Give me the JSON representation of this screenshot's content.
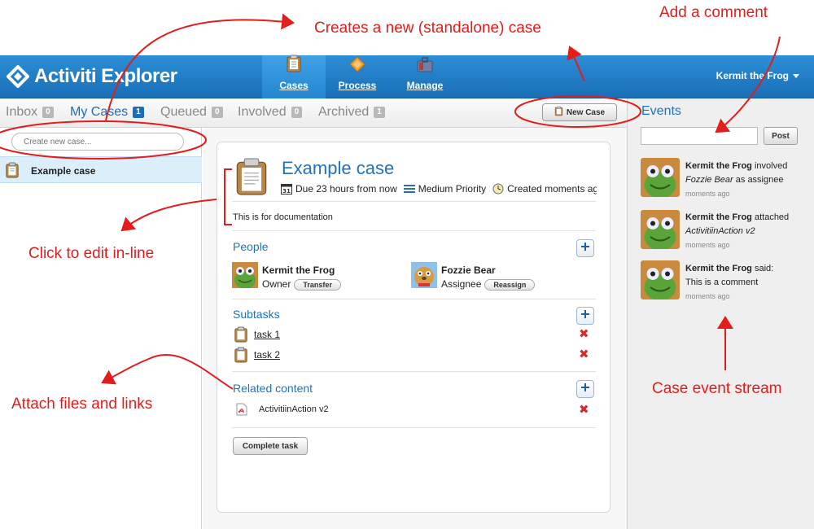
{
  "app": {
    "logo_text": "Activiti Explorer",
    "brand_color": "#1a6fb7",
    "accent_blue": "#1f73bc",
    "annotation_color": "#e31c1c"
  },
  "nav": {
    "items": [
      {
        "label": "Cases",
        "icon": "clipboard-icon",
        "active": true
      },
      {
        "label": "Process",
        "icon": "diamond-icon",
        "active": false
      },
      {
        "label": "Manage",
        "icon": "briefcase-icon",
        "active": false
      }
    ],
    "user": "Kermit the Frog"
  },
  "tabs": [
    {
      "label": "Inbox",
      "count": "0"
    },
    {
      "label": "My Cases",
      "count": "1"
    },
    {
      "label": "Queued",
      "count": "0"
    },
    {
      "label": "Involved",
      "count": "0"
    },
    {
      "label": "Archived",
      "count": "1"
    }
  ],
  "toolbar": {
    "new_case": "New Case"
  },
  "left": {
    "search_placeholder": "Create new case...",
    "items": [
      {
        "label": "Example case"
      }
    ]
  },
  "case": {
    "title": "Example case",
    "due": "Due 23 hours from now",
    "priority": "Medium Priority",
    "created": "Created moments ago",
    "calendar_day": "31",
    "description": "This is for documentation"
  },
  "people": {
    "title": "People",
    "members": [
      {
        "name": "Kermit the Frog",
        "role": "Owner",
        "action": "Transfer"
      },
      {
        "name": "Fozzie Bear",
        "role": "Assignee",
        "action": "Reassign"
      }
    ]
  },
  "subtasks": {
    "title": "Subtasks",
    "items": [
      {
        "label": "task 1"
      },
      {
        "label": "task 2"
      }
    ]
  },
  "related": {
    "title": "Related content",
    "items": [
      {
        "label": "ActivitiinAction v2"
      }
    ]
  },
  "complete_button": "Complete task",
  "events": {
    "title": "Events",
    "post": "Post",
    "items": [
      {
        "actor": "Kermit the Frog",
        "verb": "involved",
        "object": "Fozzie Bear",
        "suffix": "as assignee",
        "time": "moments ago"
      },
      {
        "actor": "Kermit the Frog",
        "verb": "attached",
        "object": "ActivitiinAction v2",
        "time": "moments ago"
      },
      {
        "actor": "Kermit the Frog",
        "verb": "said:",
        "comment": "This is a comment",
        "time": "moments ago"
      }
    ]
  },
  "annotations": {
    "new_case": "Creates a new (standalone) case",
    "add_comment": "Add a comment",
    "edit_inline": "Click to edit in-line",
    "attach": "Attach files and links",
    "event_stream": "Case event stream"
  }
}
